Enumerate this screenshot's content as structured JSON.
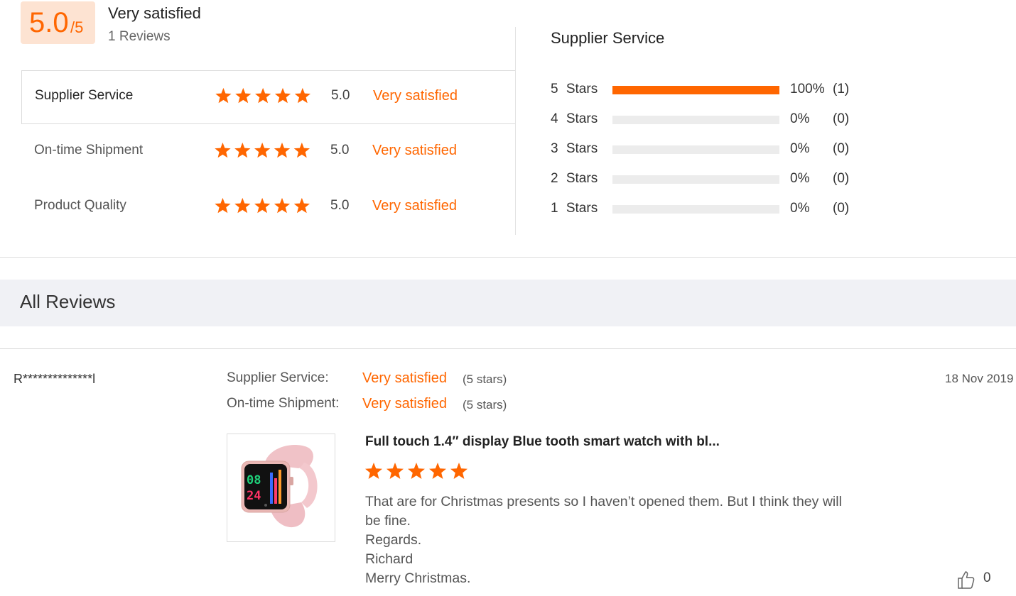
{
  "summary": {
    "score": "5.0",
    "score_max": "/5",
    "title": "Very satisfied",
    "reviews_count": "1 Reviews"
  },
  "categories": [
    {
      "label": "Supplier Service",
      "rating": 5,
      "score": "5.0",
      "text": "Very satisfied",
      "selected": true
    },
    {
      "label": "On-time Shipment",
      "rating": 5,
      "score": "5.0",
      "text": "Very satisfied",
      "selected": false
    },
    {
      "label": "Product Quality",
      "rating": 5,
      "score": "5.0",
      "text": "Very satisfied",
      "selected": false
    }
  ],
  "distribution": {
    "title": "Supplier Service",
    "rows": [
      {
        "label": "5 Stars",
        "fraction": 1.0,
        "pct": "100%",
        "count": "(1)"
      },
      {
        "label": "4 Stars",
        "fraction": 0.0,
        "pct": "0%",
        "count": "(0)"
      },
      {
        "label": "3 Stars",
        "fraction": 0.0,
        "pct": "0%",
        "count": "(0)"
      },
      {
        "label": "2 Stars",
        "fraction": 0.0,
        "pct": "0%",
        "count": "(0)"
      },
      {
        "label": "1 Stars",
        "fraction": 0.0,
        "pct": "0%",
        "count": "(0)"
      }
    ]
  },
  "all_reviews": {
    "title": "All Reviews"
  },
  "review": {
    "reviewer": "R**************l",
    "date": "18 Nov 2019",
    "ratings": [
      {
        "label": "Supplier Service:",
        "value": "Very satisfied",
        "stars": "(5 stars)"
      },
      {
        "label": "On-time Shipment:",
        "value": "Very satisfied",
        "stars": "(5 stars)"
      }
    ],
    "product_title": "Full touch 1.4″ display Blue tooth smart watch with bl...",
    "product_rating": 5,
    "watch_digits": [
      "08",
      "24"
    ],
    "body_lines": [
      "That are for Christmas presents so I haven’t opened them. But I think they will",
      "be fine.",
      "Regards.",
      "Richard",
      "Merry Christmas."
    ],
    "helpful_count": "0"
  },
  "colors": {
    "accent": "#ff6600",
    "badge_bg": "#fde3d2",
    "bar_track": "#ececec",
    "section_bg": "#f0f1f5"
  },
  "icons": [
    "star-icon",
    "thumbs-up-icon"
  ]
}
